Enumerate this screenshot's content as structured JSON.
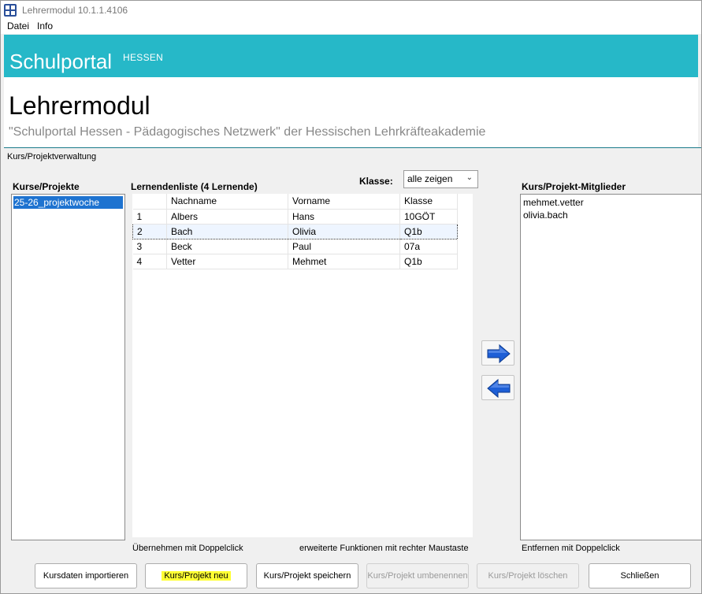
{
  "window": {
    "title": "Lehrermodul 10.1.1.4106"
  },
  "menu": {
    "file": "Datei",
    "info": "Info"
  },
  "banner": {
    "title": "Schulportal",
    "superscript": "HESSEN",
    "color": "#26b8c8"
  },
  "header": {
    "title": "Lehrermodul",
    "subtitle": "\"Schulportal Hessen - Pädagogisches Netzwerk\" der Hessischen Lehrkräfteakademie"
  },
  "section": {
    "label": "Kurs/Projektverwaltung"
  },
  "courses": {
    "heading": "Kurse/Projekte",
    "items": [
      "25-26_projektwoche"
    ],
    "selected": "25-26_projektwoche"
  },
  "learners": {
    "heading": "Lernendenliste (4 Lernende)",
    "class_filter_label": "Klasse:",
    "class_filter_value": "alle zeigen",
    "columns": [
      "",
      "Nachname",
      "Vorname",
      "Klasse"
    ],
    "rows": [
      {
        "nr": "1",
        "last": "Albers",
        "first": "Hans",
        "class": "10GÖT"
      },
      {
        "nr": "2",
        "last": "Bach",
        "first": "Olivia",
        "class": "Q1b"
      },
      {
        "nr": "3",
        "last": "Beck",
        "first": "Paul",
        "class": "07a"
      },
      {
        "nr": "4",
        "last": "Vetter",
        "first": "Mehmet",
        "class": "Q1b"
      }
    ],
    "selected_row": "2",
    "hint_left": "Übernehmen mit Doppelclick",
    "hint_right": "erweiterte Funktionen mit rechter Maustaste"
  },
  "transfer": {
    "add_icon": "arrow-right-icon",
    "remove_icon": "arrow-left-icon",
    "arrow_color": "#1e5fd6"
  },
  "members": {
    "heading": "Kurs/Projekt-Mitglieder",
    "items": [
      "mehmet.vetter",
      "olivia.bach"
    ],
    "hint": "Entfernen mit Doppelclick"
  },
  "buttons": {
    "import": "Kursdaten importieren",
    "new": "Kurs/Projekt neu",
    "save": "Kurs/Projekt speichern",
    "rename": "Kurs/Projekt umbenennen",
    "delete": "Kurs/Projekt löschen",
    "close": "Schließen"
  }
}
